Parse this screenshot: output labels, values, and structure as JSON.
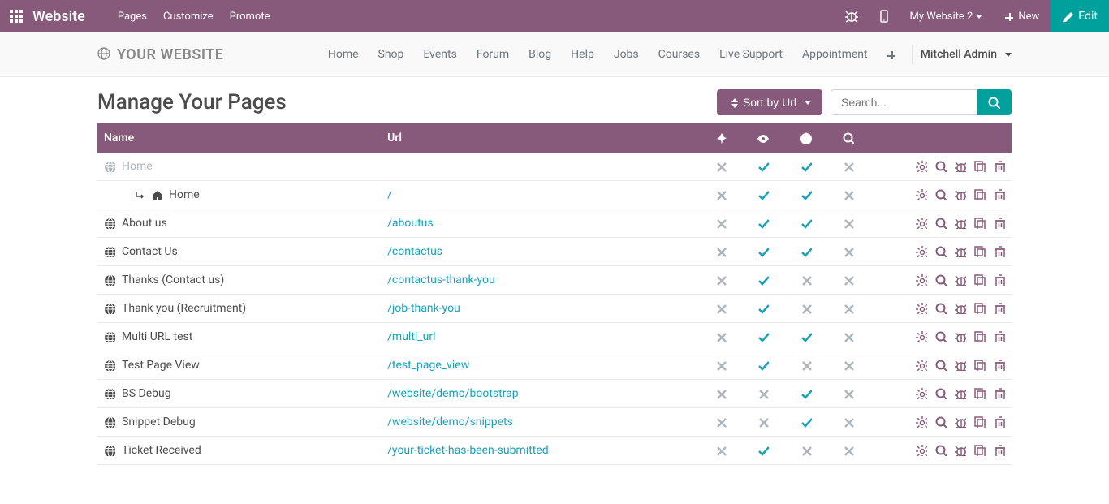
{
  "topnav": {
    "brand": "Website",
    "menus": [
      "Pages",
      "Customize",
      "Promote"
    ],
    "website_selector": "My Website 2",
    "new_btn": "New",
    "edit_btn": "Edit"
  },
  "subnav": {
    "site_name": "YOUR WEBSITE",
    "links": [
      "Home",
      "Shop",
      "Events",
      "Forum",
      "Blog",
      "Help",
      "Jobs",
      "Courses",
      "Live Support",
      "Appointment"
    ],
    "user": "Mitchell Admin"
  },
  "page": {
    "title": "Manage Your Pages",
    "sort_btn": "Sort by Url",
    "search_placeholder": "Search..."
  },
  "columns": {
    "name": "Name",
    "url": "Url"
  },
  "rows": [
    {
      "name": "Home",
      "url": "",
      "indent": false,
      "gray": true,
      "home_icon": false,
      "pin": false,
      "visible": true,
      "public": true,
      "indexed": false
    },
    {
      "name": "Home",
      "url": "/",
      "indent": true,
      "gray": false,
      "home_icon": true,
      "pin": false,
      "visible": true,
      "public": true,
      "indexed": false
    },
    {
      "name": "About us",
      "url": "/aboutus",
      "indent": false,
      "gray": false,
      "home_icon": false,
      "pin": false,
      "visible": true,
      "public": true,
      "indexed": false
    },
    {
      "name": "Contact Us",
      "url": "/contactus",
      "indent": false,
      "gray": false,
      "home_icon": false,
      "pin": false,
      "visible": true,
      "public": true,
      "indexed": false
    },
    {
      "name": "Thanks (Contact us)",
      "url": "/contactus-thank-you",
      "indent": false,
      "gray": false,
      "home_icon": false,
      "pin": false,
      "visible": true,
      "public": false,
      "indexed": false
    },
    {
      "name": "Thank you (Recruitment)",
      "url": "/job-thank-you",
      "indent": false,
      "gray": false,
      "home_icon": false,
      "pin": false,
      "visible": true,
      "public": false,
      "indexed": false
    },
    {
      "name": "Multi URL test",
      "url": "/multi_url",
      "indent": false,
      "gray": false,
      "home_icon": false,
      "pin": false,
      "visible": true,
      "public": true,
      "indexed": false
    },
    {
      "name": "Test Page View",
      "url": "/test_page_view",
      "indent": false,
      "gray": false,
      "home_icon": false,
      "pin": false,
      "visible": true,
      "public": false,
      "indexed": false
    },
    {
      "name": "BS Debug",
      "url": "/website/demo/bootstrap",
      "indent": false,
      "gray": false,
      "home_icon": false,
      "pin": false,
      "visible": false,
      "public": true,
      "indexed": false
    },
    {
      "name": "Snippet Debug",
      "url": "/website/demo/snippets",
      "indent": false,
      "gray": false,
      "home_icon": false,
      "pin": false,
      "visible": false,
      "public": true,
      "indexed": false
    },
    {
      "name": "Ticket Received",
      "url": "/your-ticket-has-been-submitted",
      "indent": false,
      "gray": false,
      "home_icon": false,
      "pin": false,
      "visible": true,
      "public": false,
      "indexed": false
    }
  ]
}
